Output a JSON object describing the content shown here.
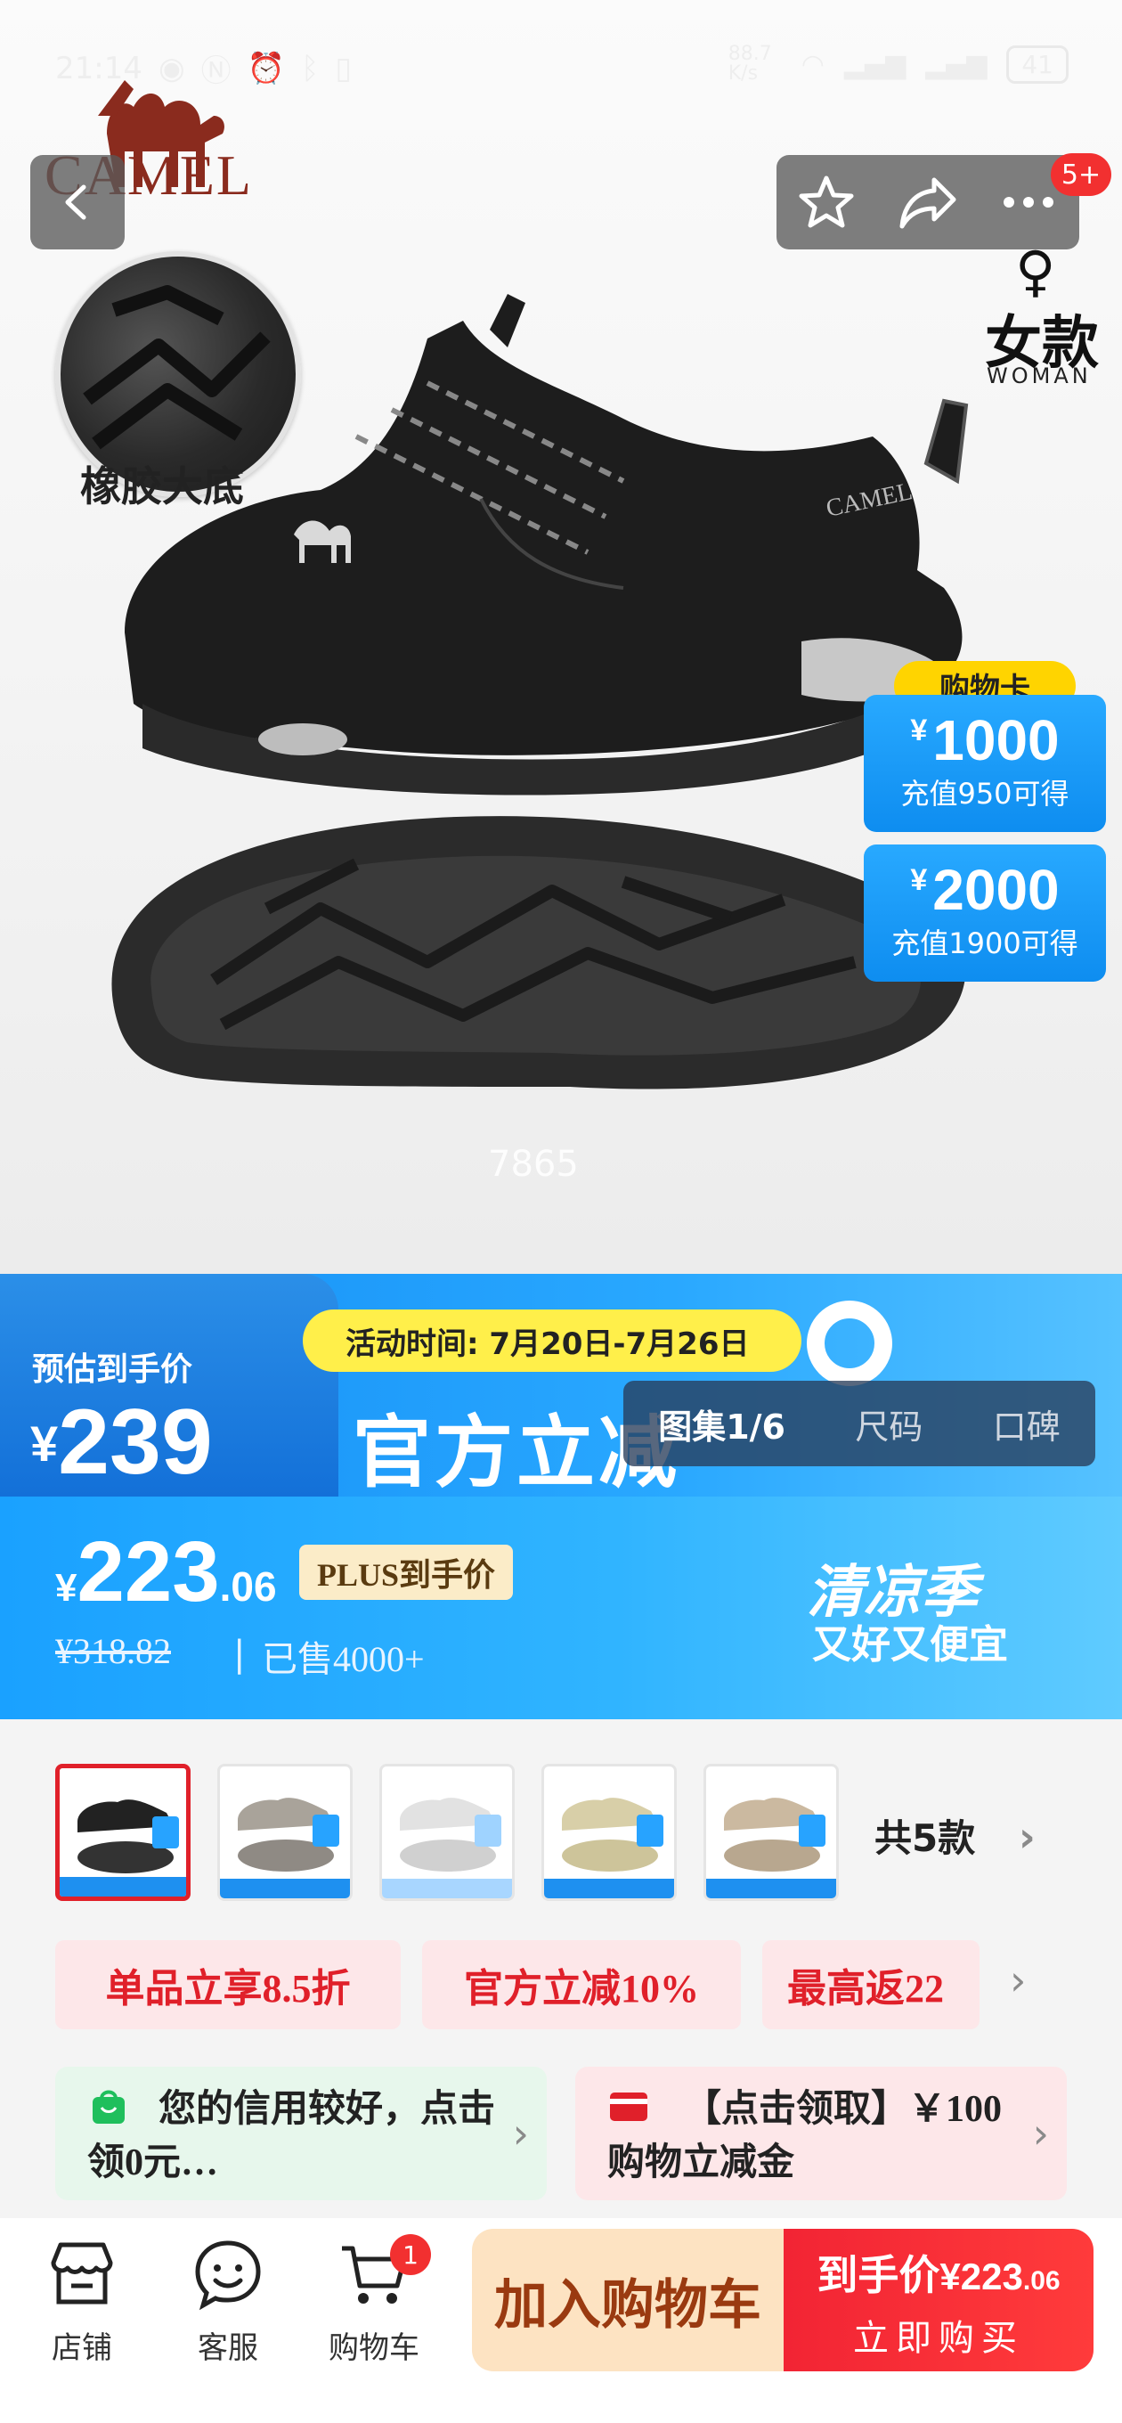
{
  "status_bar": {
    "time": "21:14",
    "net_speed": "88.7 K/s",
    "battery": "41"
  },
  "hero": {
    "brand": "CAMEL",
    "sole_label": "橡胶大底",
    "gender_symbol": "♀",
    "gender_zh": "女款",
    "gender_en": "WOMAN",
    "image_watermark": "7865",
    "notification_count": "5+",
    "gift_card": {
      "tag": "购物卡",
      "cards": [
        {
          "currency": "¥",
          "amount": "1000",
          "note": "充值950可得"
        },
        {
          "currency": "¥",
          "amount": "2000",
          "note": "充值1900可得"
        }
      ]
    }
  },
  "promo": {
    "event_time": "活动时间: 7月20日-7月26日",
    "estimate_label": "预估到手价",
    "estimate_currency": "¥",
    "estimate_price": "239",
    "headline": "官方立减",
    "gallery_tabs": [
      "图集1/6",
      "尺码",
      "口碑"
    ]
  },
  "price": {
    "currency": "¥",
    "integer": "223",
    "decimal": ".06",
    "plus_label": "PLUS到手价",
    "original": "¥318.82",
    "divider": "|",
    "sold": "已售4000+",
    "season_title": "清凉季",
    "season_subtitle": "又好又便宜"
  },
  "variants": {
    "count_label": "共5款",
    "items": [
      {
        "name": "black",
        "selected": true
      },
      {
        "name": "grey"
      },
      {
        "name": "white"
      },
      {
        "name": "beige"
      },
      {
        "name": "khaki"
      }
    ]
  },
  "coupons": [
    "单品立享8.5折",
    "官方立减10%",
    "最高返22"
  ],
  "info_cards": {
    "credit": "您的信用较好，点击领0元…",
    "claim": "【点击领取】￥100购物立减金"
  },
  "bottom_nav": {
    "shop": "店铺",
    "service": "客服",
    "cart": "购物车",
    "cart_count": "1",
    "add_to_cart": "加入购物车",
    "buy_price_label": "到手价",
    "buy_price_int": "¥223",
    "buy_price_dec": ".06",
    "buy_now": "立即购买"
  },
  "colors": {
    "accent_red": "#e0202a",
    "promo_blue": "#1aa1ff",
    "yellow": "#ffd400"
  }
}
